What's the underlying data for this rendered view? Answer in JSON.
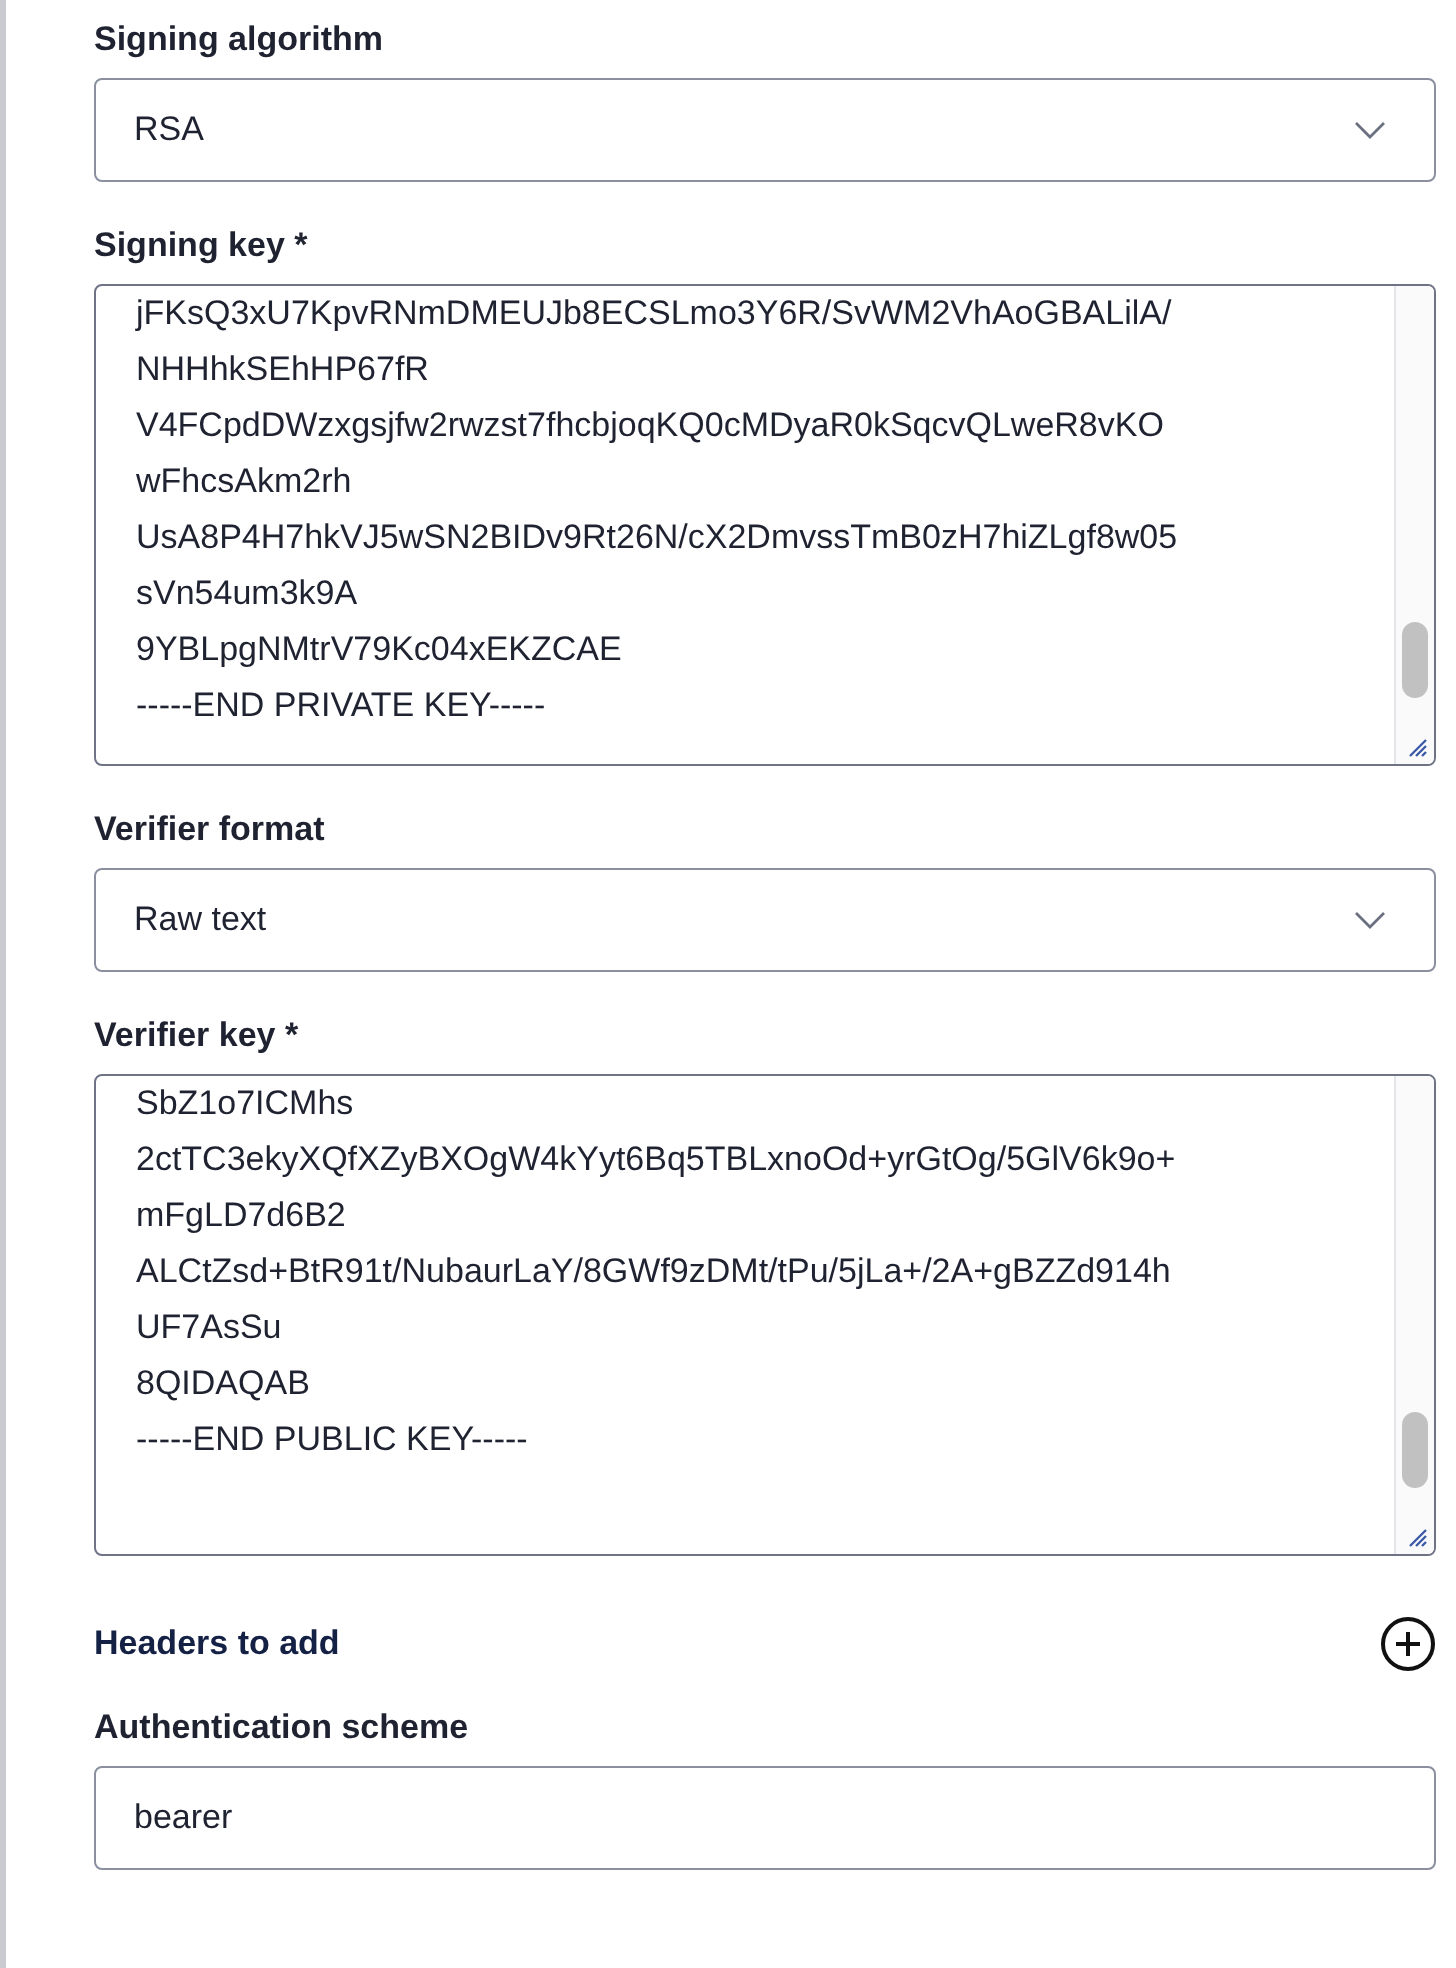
{
  "fields": [
    {
      "kind": "select",
      "label": "Signing algorithm",
      "value": "RSA"
    },
    {
      "kind": "textarea",
      "label": "Signing key *",
      "lines": [
        "jFKsQ3xU7KpvRNmDMEUJb8ECSLmo3Y6R/SvWM2VhAoGBALilA/",
        "NHHhkSEhHP67fR",
        "V4FCpdDWzxgsjfw2rwzst7fhcbjoqKQ0cMDyaR0kSqcvQLweR8vKO",
        "wFhcsAkm2rh",
        "UsA8P4H7hkVJ5wSN2BIDv9Rt26N/cX2DmvssTmB0zH7hiZLgf8w05",
        "sVn54um3k9A",
        "9YBLpgNMtrV79Kc04xEKZCAE",
        "-----END PRIVATE KEY-----"
      ]
    },
    {
      "kind": "select",
      "label": "Verifier format",
      "value": "Raw text"
    },
    {
      "kind": "textarea",
      "label": "Verifier key *",
      "lines": [
        "SbZ1o7ICMhs",
        "2ctTC3ekyXQfXZyBXOgW4kYyt6Bq5TBLxnoOd+yrGtOg/5GlV6k9o+",
        "mFgLD7d6B2",
        "ALCtZsd+BtR91t/NubaurLaY/8GWf9zDMt/tPu/5jLa+/2A+gBZZd914h",
        "UF7AsSu",
        "8QIDAQAB",
        "-----END PUBLIC KEY-----"
      ]
    },
    {
      "kind": "add",
      "label": "Headers to add"
    },
    {
      "kind": "input",
      "label": "Authentication scheme",
      "value": "bearer"
    }
  ]
}
